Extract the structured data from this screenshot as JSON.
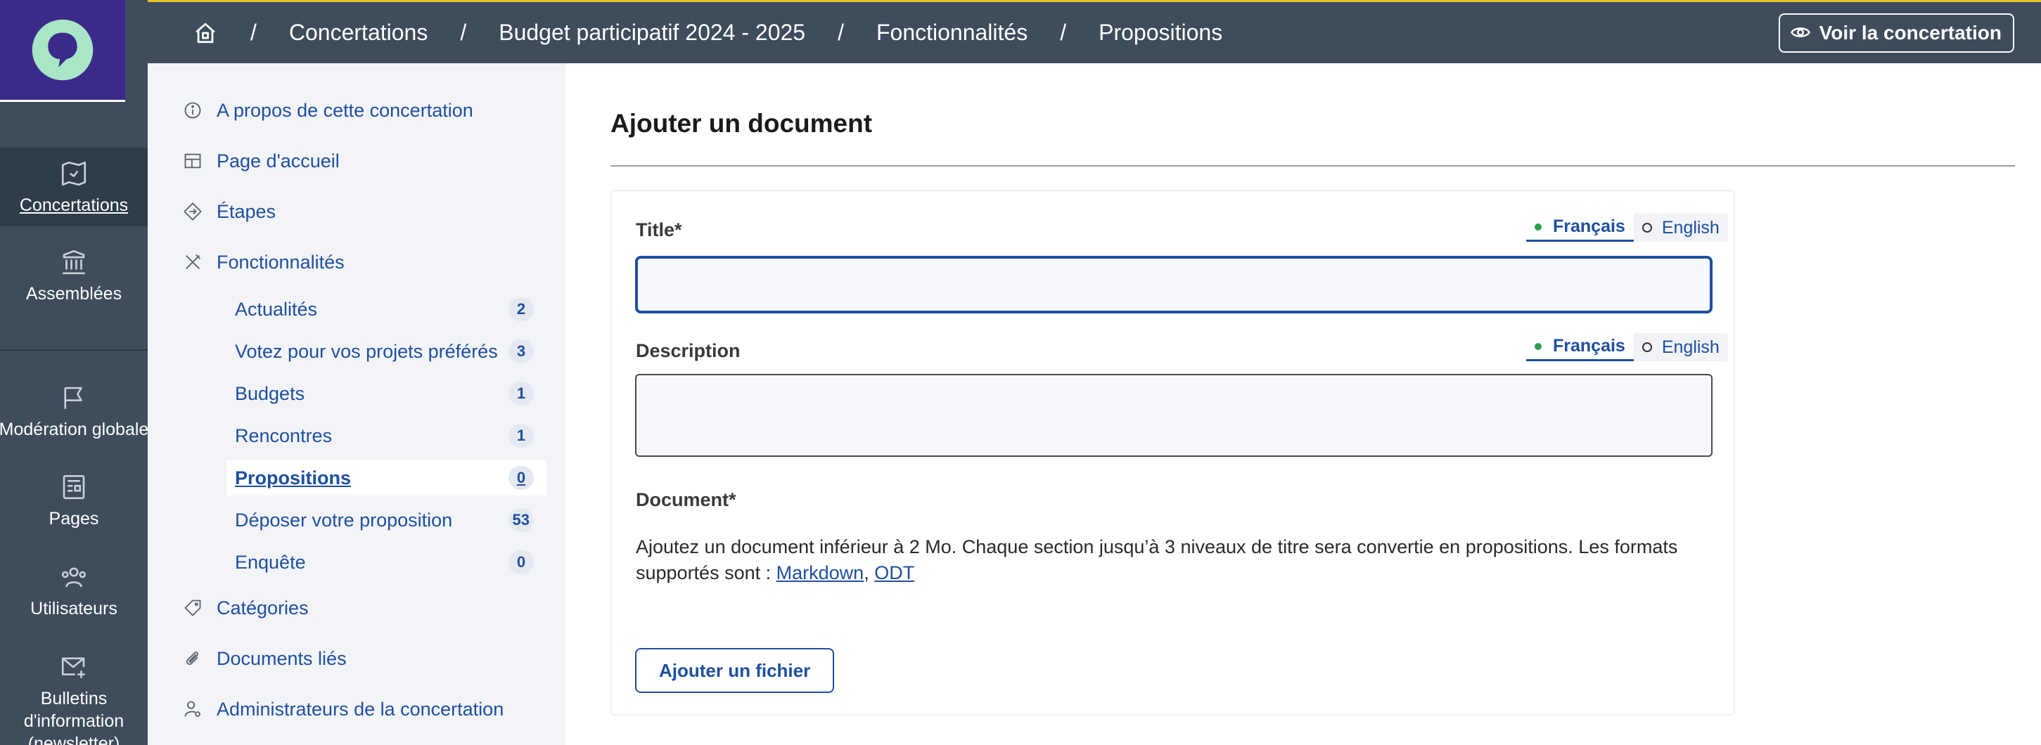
{
  "breadcrumb": {
    "items": [
      "Concertations",
      "Budget participatif 2024 - 2025",
      "Fonctionnalités",
      "Propositions"
    ],
    "separator": "/"
  },
  "header": {
    "view_button": "Voir la concertation"
  },
  "mainnav": {
    "items": [
      {
        "label": "Concertations",
        "icon": "map-icon",
        "active": true
      },
      {
        "label": "Assemblées",
        "icon": "building-icon",
        "active": false
      },
      {
        "label": "Modération globale",
        "icon": "flag-icon",
        "active": false
      },
      {
        "label": "Pages",
        "icon": "page-icon",
        "active": false
      },
      {
        "label": "Utilisateurs",
        "icon": "users-icon",
        "active": false
      },
      {
        "label": "Bulletins d'information (newsletter)",
        "icon": "mail-add-icon",
        "active": false
      }
    ]
  },
  "subnav": {
    "about": "A propos de cette concertation",
    "home": "Page d'accueil",
    "steps": "Étapes",
    "features": "Fonctionnalités",
    "feature_items": [
      {
        "label": "Actualités",
        "count": "2"
      },
      {
        "label": "Votez pour vos projets préférés",
        "count": "3"
      },
      {
        "label": "Budgets",
        "count": "1"
      },
      {
        "label": "Rencontres",
        "count": "1"
      },
      {
        "label": "Propositions",
        "count": "0"
      },
      {
        "label": "Déposer votre proposition",
        "count": "53"
      },
      {
        "label": "Enquête",
        "count": "0"
      }
    ],
    "categories": "Catégories",
    "documents": "Documents liés",
    "admins": "Administrateurs de la concertation"
  },
  "main": {
    "title": "Ajouter un document",
    "title_field": {
      "label": "Title*",
      "value": "",
      "placeholder": ""
    },
    "description_field": {
      "label": "Description",
      "value": "",
      "placeholder": ""
    },
    "languages": {
      "fr": "Français",
      "en": "English"
    },
    "document_label": "Document*",
    "help_text": "Ajoutez un document inférieur à 2 Mo. Chaque section jusqu’à 3 niveaux de titre sera convertie en propositions. Les formats supportés sont :",
    "help_link_markdown": "Markdown",
    "help_link_separator": ", ",
    "help_link_odt": "ODT",
    "add_file_button": "Ajouter un fichier"
  },
  "colors": {
    "nav_bg": "#3e4c5c",
    "logo_bg": "#3b2a8a",
    "logo_accent": "#a8e6c6",
    "link": "#1e4fa0",
    "top_accent": "#e6c229",
    "active_dot": "#2e9e4f"
  }
}
